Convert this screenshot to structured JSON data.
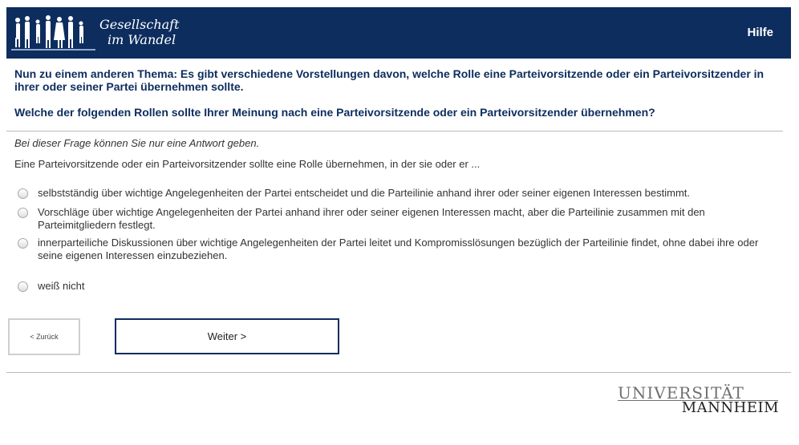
{
  "header": {
    "brand_line1": "Gesellschaft",
    "brand_line2": "im Wandel",
    "help_label": "Hilfe",
    "bg_color": "#0d2d5e"
  },
  "question": {
    "intro": "Nun zu einem anderen Thema: Es gibt verschiedene Vorstellungen davon, welche Rolle eine Parteivorsitzende oder ein Parteivorsitzender in ihrer oder seiner Partei übernehmen sollte.",
    "main": "Welche der folgenden Rollen sollte Ihrer Meinung nach eine Parteivorsitzende oder ein Parteivorsitzender übernehmen?",
    "instruction": "Bei dieser Frage können Sie nur eine Antwort geben.",
    "stem": "Eine Parteivorsitzende oder ein Parteivorsitzender sollte eine Rolle übernehmen, in der sie oder er ..."
  },
  "options": [
    "selbstständig über wichtige Angelegenheiten der Partei entscheidet und die Parteilinie anhand ihrer oder seiner eigenen Interessen bestimmt.",
    "Vorschläge über wichtige Angelegenheiten der Partei anhand ihrer oder seiner eigenen Interessen macht, aber die Parteilinie zusammen mit den Parteimitgliedern festlegt.",
    "innerparteiliche Diskussionen über wichtige Angelegenheiten der Partei leitet und Kompromisslösungen bezüglich der Parteilinie findet, ohne dabei ihre oder seine eigenen Interessen einzubeziehen.",
    "weiß nicht"
  ],
  "nav": {
    "back_label": "< Zurück",
    "next_label": "Weiter >"
  },
  "footer": {
    "logo_line1": "UNIVERSITÄT",
    "logo_line2": "MANNHEIM"
  }
}
